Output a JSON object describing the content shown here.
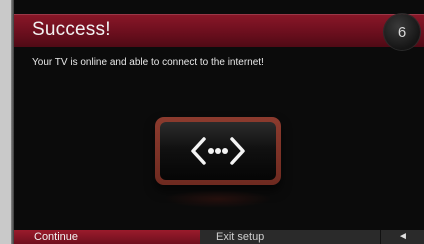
{
  "header": {
    "title": "Success!",
    "step": "6"
  },
  "main": {
    "message": "Your TV is online and able to connect to the internet!",
    "icon": "network-connection-icon"
  },
  "footer": {
    "continue_label": "Continue",
    "exit_label": "Exit setup",
    "back_icon": "◄"
  },
  "colors": {
    "accent": "#8a1728",
    "background": "#0b0b0b"
  }
}
